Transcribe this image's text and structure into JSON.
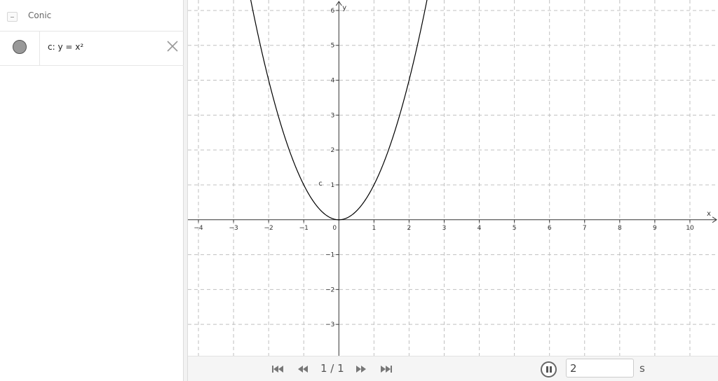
{
  "algebra": {
    "group_label": "Conic",
    "items": [
      {
        "definition": "c: y = x²"
      }
    ]
  },
  "graphics": {
    "x_axis_label": "x",
    "y_axis_label": "y",
    "curve_label": "c",
    "x_ticks": [
      -4,
      -3,
      -2,
      -1,
      0,
      1,
      2,
      3,
      4,
      5,
      6,
      7,
      8,
      9,
      10
    ],
    "y_ticks": [
      -3,
      -2,
      -1,
      1,
      2,
      3,
      4,
      5,
      6
    ],
    "x_range": [
      -4.3,
      10.8
    ],
    "y_range": [
      -3.9,
      6.3
    ],
    "curve_color": "#000000",
    "grid_color": "#c0c0c0"
  },
  "playbar": {
    "slide_counter": "1 / 1",
    "time_value": "2",
    "time_unit": "s"
  }
}
